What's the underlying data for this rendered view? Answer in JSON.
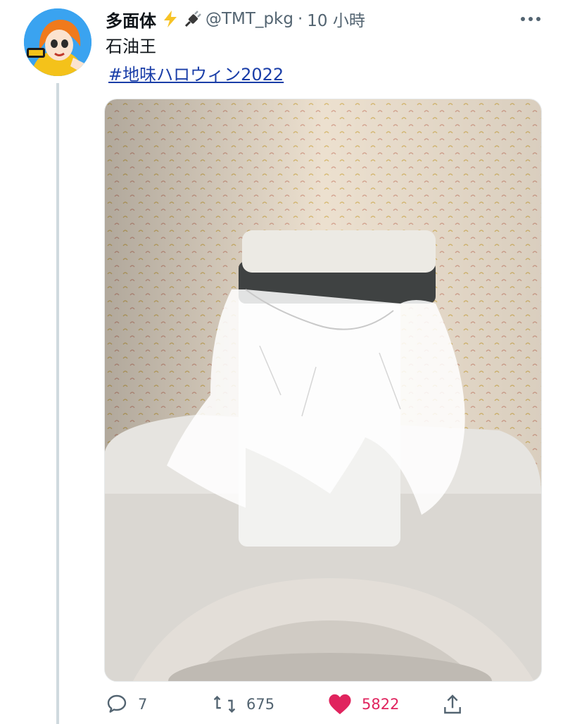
{
  "tweet": {
    "author_name": "多面体",
    "author_handle": "@TMT_pkg",
    "separator": "·",
    "time": "10 小時",
    "emoji_icons": [
      "lightning-emoji",
      "plug-emoji"
    ],
    "text": "石油王",
    "hashtag": "#地味ハロウィン2022",
    "media_icon": "photo-of-trash-can-in-plastic-bag-on-toilet-tank"
  },
  "actions": {
    "reply_count": "7",
    "retweet_count": "675",
    "like_count": "5822",
    "icons": [
      "reply-icon",
      "retweet-icon",
      "heart-icon",
      "share-icon"
    ]
  },
  "colors": {
    "secondary_text": "#536471",
    "link": "#1a3ea8",
    "like": "#e0245e",
    "thread_line": "#cfd9de"
  }
}
